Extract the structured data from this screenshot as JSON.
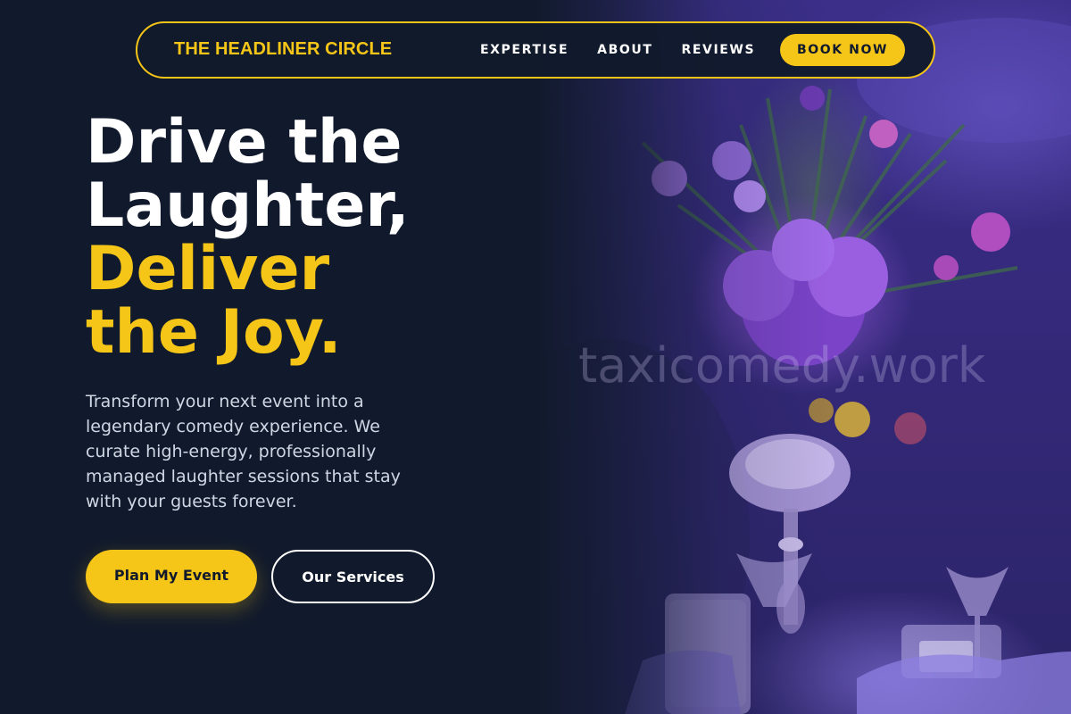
{
  "navbar": {
    "brand": "THE HEADLINER CIRCLE",
    "links": [
      "EXPERTISE",
      "ABOUT",
      "REVIEWS"
    ],
    "cta": "BOOK NOW"
  },
  "hero": {
    "headline_line1": "Drive the",
    "headline_line2": "Laughter,",
    "headline_line3": "Deliver",
    "headline_line4": "the Joy.",
    "subtext": "Transform your next event into a legendary comedy experience. We curate high-energy, professionally managed laughter sessions that stay with your guests forever.",
    "primary_button": "Plan My Event",
    "secondary_button": "Our Services",
    "image_watermark": "taxicomedy.work"
  },
  "colors": {
    "background": "#111a2c",
    "accent": "#f5c518",
    "text": "#ffffff",
    "muted_text": "#cfd6e4"
  }
}
